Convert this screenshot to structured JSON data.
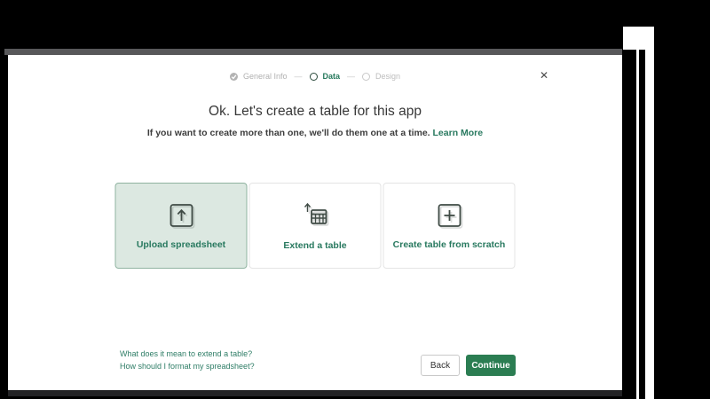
{
  "stepper": {
    "separator": "—",
    "steps": [
      {
        "label": "General Info",
        "state": "done"
      },
      {
        "label": "Data",
        "state": "active"
      },
      {
        "label": "Design",
        "state": "upcoming"
      }
    ]
  },
  "close_label": "✕",
  "header": {
    "title": "Ok. Let's create a table for this app",
    "subtitle": "If you want to create more than one, we'll do them one at a time.",
    "learn_more": "Learn More"
  },
  "cards": [
    {
      "label": "Upload spreadsheet",
      "icon": "upload-icon",
      "selected": true
    },
    {
      "label": "Extend a table",
      "icon": "extend-table-icon",
      "selected": false
    },
    {
      "label": "Create table from scratch",
      "icon": "new-table-icon",
      "selected": false
    }
  ],
  "help_links": [
    "What does it mean to extend a table?",
    "How should I format my spreadsheet?"
  ],
  "footer": {
    "back_label": "Back",
    "continue_label": "Continue"
  },
  "colors": {
    "accent_green": "#28795f",
    "continue_button_green": "#2b7d52",
    "selected_card_bg": "#dce8e1",
    "selected_card_border": "#8fb3a0",
    "inactive_gray": "#b3b3b3"
  }
}
